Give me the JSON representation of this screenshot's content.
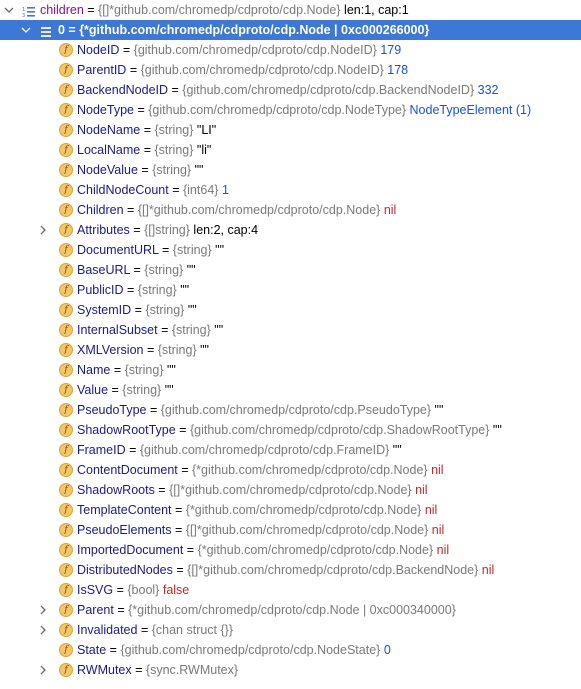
{
  "root": {
    "name": "children",
    "type": "{[]*github.com/chromedp/cdproto/cdp.Node}",
    "value": "len:1, cap:1"
  },
  "selected": {
    "text": "0 = {*github.com/chromedp/cdproto/cdp.Node | 0xc000266000}"
  },
  "fields": [
    {
      "name": "NodeID",
      "type": "{github.com/chromedp/cdproto/cdp.NodeID}",
      "value": "179",
      "kind": "num",
      "expandable": false
    },
    {
      "name": "ParentID",
      "type": "{github.com/chromedp/cdproto/cdp.NodeID}",
      "value": "178",
      "kind": "num",
      "expandable": false
    },
    {
      "name": "BackendNodeID",
      "type": "{github.com/chromedp/cdproto/cdp.BackendNodeID}",
      "value": "332",
      "kind": "num",
      "expandable": false
    },
    {
      "name": "NodeType",
      "type": "{github.com/chromedp/cdproto/cdp.NodeType}",
      "value": "NodeTypeElement (1)",
      "kind": "blue",
      "expandable": false
    },
    {
      "name": "NodeName",
      "type": "{string}",
      "value": "\"LI\"",
      "kind": "str",
      "expandable": false
    },
    {
      "name": "LocalName",
      "type": "{string}",
      "value": "\"li\"",
      "kind": "str",
      "expandable": false
    },
    {
      "name": "NodeValue",
      "type": "{string}",
      "value": "\"\"",
      "kind": "str",
      "expandable": false
    },
    {
      "name": "ChildNodeCount",
      "type": "{int64}",
      "value": "1",
      "kind": "num",
      "expandable": false
    },
    {
      "name": "Children",
      "type": "{[]*github.com/chromedp/cdproto/cdp.Node}",
      "value": "nil",
      "kind": "nil",
      "expandable": false
    },
    {
      "name": "Attributes",
      "type": "{[]string}",
      "value": "len:2, cap:4",
      "kind": "plain",
      "expandable": true
    },
    {
      "name": "DocumentURL",
      "type": "{string}",
      "value": "\"\"",
      "kind": "str",
      "expandable": false
    },
    {
      "name": "BaseURL",
      "type": "{string}",
      "value": "\"\"",
      "kind": "str",
      "expandable": false
    },
    {
      "name": "PublicID",
      "type": "{string}",
      "value": "\"\"",
      "kind": "str",
      "expandable": false
    },
    {
      "name": "SystemID",
      "type": "{string}",
      "value": "\"\"",
      "kind": "str",
      "expandable": false
    },
    {
      "name": "InternalSubset",
      "type": "{string}",
      "value": "\"\"",
      "kind": "str",
      "expandable": false
    },
    {
      "name": "XMLVersion",
      "type": "{string}",
      "value": "\"\"",
      "kind": "str",
      "expandable": false
    },
    {
      "name": "Name",
      "type": "{string}",
      "value": "\"\"",
      "kind": "str",
      "expandable": false
    },
    {
      "name": "Value",
      "type": "{string}",
      "value": "\"\"",
      "kind": "str",
      "expandable": false
    },
    {
      "name": "PseudoType",
      "type": "{github.com/chromedp/cdproto/cdp.PseudoType}",
      "value": "\"\"",
      "kind": "str",
      "expandable": false
    },
    {
      "name": "ShadowRootType",
      "type": "{github.com/chromedp/cdproto/cdp.ShadowRootType}",
      "value": "\"\"",
      "kind": "str",
      "expandable": false
    },
    {
      "name": "FrameID",
      "type": "{github.com/chromedp/cdproto/cdp.FrameID}",
      "value": "\"\"",
      "kind": "str",
      "expandable": false
    },
    {
      "name": "ContentDocument",
      "type": "{*github.com/chromedp/cdproto/cdp.Node}",
      "value": "nil",
      "kind": "nil",
      "expandable": false
    },
    {
      "name": "ShadowRoots",
      "type": "{[]*github.com/chromedp/cdproto/cdp.Node}",
      "value": "nil",
      "kind": "nil",
      "expandable": false
    },
    {
      "name": "TemplateContent",
      "type": "{*github.com/chromedp/cdproto/cdp.Node}",
      "value": "nil",
      "kind": "nil",
      "expandable": false
    },
    {
      "name": "PseudoElements",
      "type": "{[]*github.com/chromedp/cdproto/cdp.Node}",
      "value": "nil",
      "kind": "nil",
      "expandable": false
    },
    {
      "name": "ImportedDocument",
      "type": "{*github.com/chromedp/cdproto/cdp.Node}",
      "value": "nil",
      "kind": "nil",
      "expandable": false
    },
    {
      "name": "DistributedNodes",
      "type": "{[]*github.com/chromedp/cdproto/cdp.BackendNode}",
      "value": "nil",
      "kind": "nil",
      "expandable": false
    },
    {
      "name": "IsSVG",
      "type": "{bool}",
      "value": "false",
      "kind": "false",
      "expandable": false
    },
    {
      "name": "Parent",
      "type": "{*github.com/chromedp/cdproto/cdp.Node | 0xc000340000}",
      "value": "",
      "kind": "plain",
      "expandable": true
    },
    {
      "name": "Invalidated",
      "type": "{chan struct {}}",
      "value": "",
      "kind": "plain",
      "expandable": true
    },
    {
      "name": "State",
      "type": "{github.com/chromedp/cdproto/cdp.NodeState}",
      "value": "0",
      "kind": "num",
      "expandable": false
    },
    {
      "name": "RWMutex",
      "type": "{sync.RWMutex}",
      "value": "",
      "kind": "plain",
      "expandable": true
    }
  ],
  "icons": {
    "field": "field-icon",
    "list": "list-icon",
    "expand": "chevron-right-icon",
    "collapse": "chevron-down-icon"
  },
  "colors": {
    "selection": "#3d78d6",
    "nil": "#c62828",
    "number": "#1750eb",
    "type": "#7a7a7a",
    "field_icon": "#f3c66a"
  }
}
